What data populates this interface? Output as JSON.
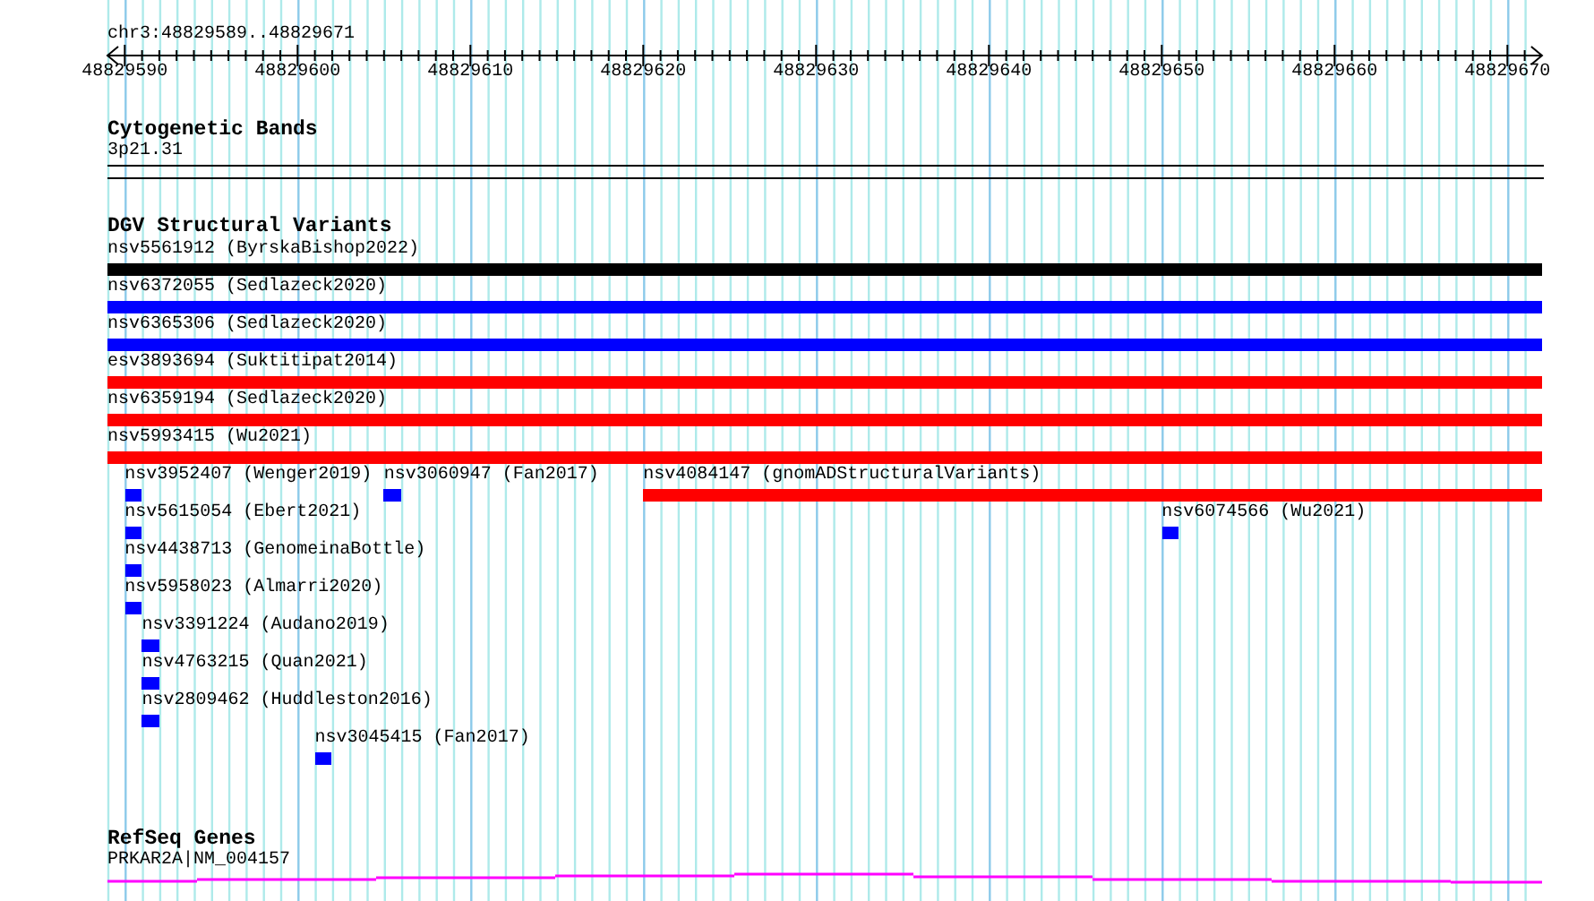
{
  "ruler": {
    "position": "chr3:48829589..48829671",
    "ticks": [
      "48829590",
      "48829600",
      "48829610",
      "48829620",
      "48829630",
      "48829640",
      "48829650",
      "48829660",
      "48829670"
    ]
  },
  "tracks": [
    {
      "title": "Cytogenetic Bands",
      "kind": "bands",
      "items": [
        {
          "label": "3p21.31"
        }
      ]
    },
    {
      "title": "DGV Structural Variants",
      "kind": "variants",
      "items": [
        {
          "label": "nsv5561912 (ByrskaBishop2022)",
          "color": "#000000"
        },
        {
          "label": "nsv6372055 (Sedlazeck2020)",
          "color": "#0000ff"
        },
        {
          "label": "nsv6365306 (Sedlazeck2020)",
          "color": "#0000ff"
        },
        {
          "label": "esv3893694 (Suktitipat2014)",
          "color": "#ff0000"
        },
        {
          "label": "nsv6359194 (Sedlazeck2020)",
          "color": "#ff0000"
        },
        {
          "label": "nsv5993415 (Wu2021)",
          "color": "#ff0000"
        },
        {
          "label": "nsv3952407 (Wenger2019)",
          "color": "#0000ff"
        },
        {
          "label": "nsv3060947 (Fan2017)",
          "color": "#0000ff"
        },
        {
          "label": "nsv4084147 (gnomADStructuralVariants)",
          "color": "#ff0000"
        },
        {
          "label": "nsv5615054 (Ebert2021)",
          "color": "#0000ff"
        },
        {
          "label": "nsv6074566 (Wu2021)",
          "color": "#0000ff"
        },
        {
          "label": "nsv4438713 (GenomeinaBottle)",
          "color": "#0000ff"
        },
        {
          "label": "nsv5958023 (Almarri2020)",
          "color": "#0000ff"
        },
        {
          "label": "nsv3391224 (Audano2019)",
          "color": "#0000ff"
        },
        {
          "label": "nsv4763215 (Quan2021)",
          "color": "#0000ff"
        },
        {
          "label": "nsv2809462 (Huddleston2016)",
          "color": "#0000ff"
        },
        {
          "label": "nsv3045415 (Fan2017)",
          "color": "#0000ff"
        }
      ]
    },
    {
      "title": "RefSeq Genes",
      "kind": "genes",
      "items": [
        {
          "label": "PRKAR2A|NM_004157",
          "color": "#ff00ff"
        }
      ]
    }
  ]
}
